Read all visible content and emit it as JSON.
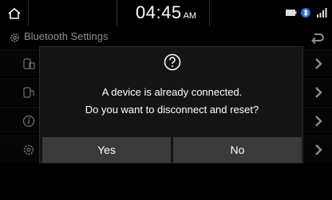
{
  "status_bar": {
    "time": "04:45",
    "ampm": "AM",
    "icons": [
      "home-icon",
      "battery-icon",
      "bluetooth-phone-icon",
      "signal-icon"
    ]
  },
  "header": {
    "title": "Bluetooth Settings",
    "icons": [
      "gear-icon",
      "back-icon"
    ]
  },
  "list": {
    "rows": [
      {
        "icon": "phone-connection-icon"
      },
      {
        "icon": "phone-priority-icon"
      },
      {
        "icon": "info-icon"
      },
      {
        "icon": "settings-gear-icon"
      }
    ]
  },
  "dialog": {
    "icon": "question-icon",
    "message_line1": "A device is already connected.",
    "message_line2": "Do you want to disconnect and reset?",
    "yes_label": "Yes",
    "no_label": "No"
  },
  "colors": {
    "background": "#000000",
    "dialog_bg": "#141414",
    "button_bg": "#3a3a3a",
    "text": "#ffffff"
  }
}
